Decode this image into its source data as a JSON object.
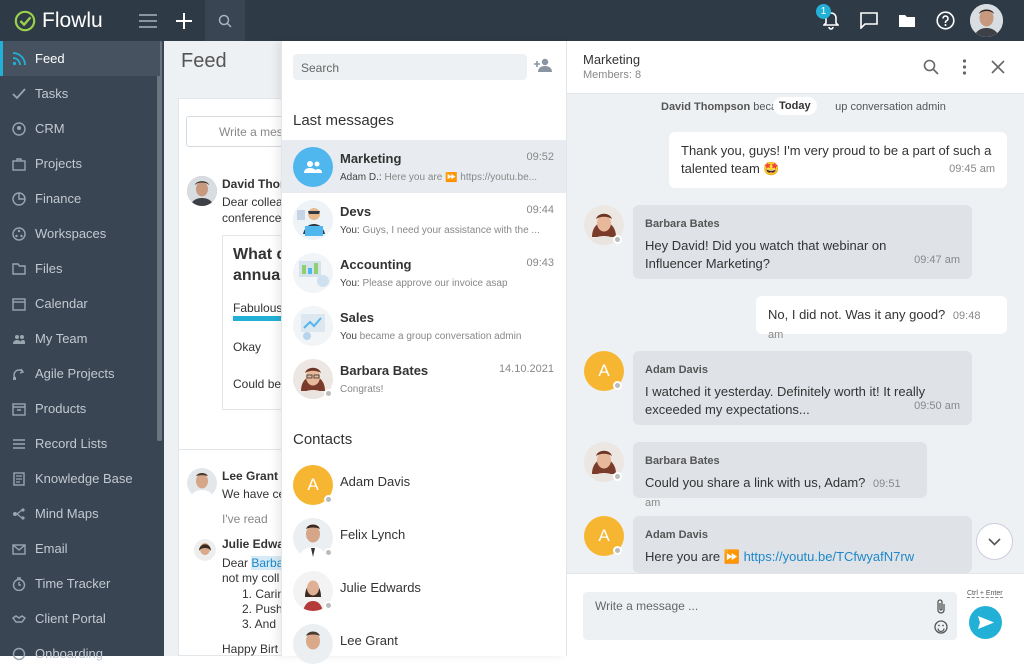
{
  "topbar": {
    "app_name": "Flowlu",
    "notification_count": "1"
  },
  "sidebar": {
    "items": [
      {
        "label": "Feed",
        "icon": "rss-icon"
      },
      {
        "label": "Tasks",
        "icon": "check-icon"
      },
      {
        "label": "CRM",
        "icon": "user-circle-icon"
      },
      {
        "label": "Projects",
        "icon": "briefcase-icon"
      },
      {
        "label": "Finance",
        "icon": "pie-icon"
      },
      {
        "label": "Workspaces",
        "icon": "workspaces-icon"
      },
      {
        "label": "Files",
        "icon": "folder-icon"
      },
      {
        "label": "Calendar",
        "icon": "calendar-icon"
      },
      {
        "label": "My Team",
        "icon": "team-icon"
      },
      {
        "label": "Agile Projects",
        "icon": "agile-icon"
      },
      {
        "label": "Products",
        "icon": "box-icon"
      },
      {
        "label": "Record Lists",
        "icon": "list-icon"
      },
      {
        "label": "Knowledge Base",
        "icon": "book-icon"
      },
      {
        "label": "Mind Maps",
        "icon": "mindmap-icon"
      },
      {
        "label": "Email",
        "icon": "mail-icon"
      },
      {
        "label": "Time Tracker",
        "icon": "clock-icon"
      },
      {
        "label": "Client Portal",
        "icon": "handshake-icon"
      },
      {
        "label": "Onboarding",
        "icon": "onboarding-icon"
      }
    ]
  },
  "feed": {
    "title": "Feed",
    "write_placeholder": "Write a mes",
    "post1_author": "David Thor",
    "post1_line1": "Dear collea",
    "post1_line2": "conference",
    "poll_title1": "What d",
    "poll_title2": "annual",
    "poll_opt1": "Fabulous",
    "poll_opt2": "Okay",
    "poll_opt3": "Could be",
    "post2_author": "Lee Grant",
    "post2_line1": "We have ce",
    "post2_read": "I've read",
    "reply_author": "Julie Edwa",
    "reply_line1_a": "Dear",
    "reply_line1_b": "Barba",
    "reply_line2": "not my coll",
    "reply_li1": "1. Carin",
    "reply_li2": "2. Push",
    "reply_li3": "3. And",
    "reply_line3": "Happy Birt"
  },
  "chatlist": {
    "search_placeholder": "Search",
    "last_messages_title": "Last messages",
    "contacts_title": "Contacts",
    "chats": [
      {
        "name": "Marketing",
        "time": "09:52",
        "sender": "Adam D.:",
        "preview": "Here you are ⏩ https://youtu.be..."
      },
      {
        "name": "Devs",
        "time": "09:44",
        "sender": "You:",
        "preview": "Guys, I need your assistance with the ..."
      },
      {
        "name": "Accounting",
        "time": "09:43",
        "sender": "You:",
        "preview": "Please approve our invoice asap"
      },
      {
        "name": "Sales",
        "time": "",
        "sender": "You",
        "preview": "became a group conversation admin"
      },
      {
        "name": "Barbara Bates",
        "time": "14.10.2021",
        "sender": "",
        "preview": "Congrats!"
      }
    ],
    "contacts": [
      {
        "name": "Adam Davis",
        "initial": "A"
      },
      {
        "name": "Felix Lynch"
      },
      {
        "name": "Julie Edwards"
      },
      {
        "name": "Lee Grant"
      }
    ]
  },
  "chat": {
    "title": "Marketing",
    "members": "Members: 8",
    "system_line_a": "David Thompson",
    "system_line_b": "beca",
    "system_line_c": "up conversation admin",
    "today": "Today",
    "messages": [
      {
        "dir": "out",
        "text": "Thank you, guys! I'm very proud to be a part of such a talented team 🤩",
        "time": "09:45 am"
      },
      {
        "dir": "in",
        "sender": "Barbara Bates",
        "text": "Hey David! Did you watch that webinar on Influencer Marketing?",
        "time": "09:47 am"
      },
      {
        "dir": "out",
        "text": "No, I did not. Was it any good?",
        "time": "09:48 am"
      },
      {
        "dir": "in",
        "sender": "Adam Davis",
        "text": "I watched it yesterday. Definitely worth it! It really exceeded my expectations...",
        "time": "09:50 am"
      },
      {
        "dir": "in",
        "sender": "Barbara Bates",
        "text": "Could you share a link with us, Adam?",
        "time": "09:51 am"
      },
      {
        "dir": "in",
        "sender": "Adam Davis",
        "text": "Here you are ⏩",
        "link": "https://youtu.be/TCfwyafN7rw"
      }
    ],
    "composer_placeholder": "Write a message ...",
    "shortcut": "Ctrl + Enter"
  },
  "colors": {
    "topbar": "#2f3a47",
    "sidebar": "#3a4553",
    "accent": "#23b0d6",
    "avatar_yellow": "#f6b631"
  }
}
